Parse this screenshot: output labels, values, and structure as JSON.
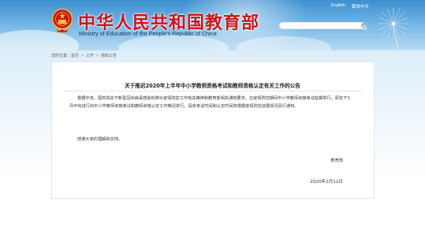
{
  "header": {
    "title_zh": "中华人民共和国教育部",
    "title_en": "Ministry of Education of the People's Republic of China",
    "links": [
      {
        "label": "English"
      },
      {
        "label": "繁体中文"
      }
    ],
    "search": {
      "placeholder": ""
    }
  },
  "breadcrumb": [
    "您的位置：首页",
    "公开",
    "通知公告"
  ],
  "article": {
    "title": "关于推迟2020年上半年中小学教师资格考试和教师资格认定有关工作的公告",
    "paragraphs": [
      "根据中央、国务院关于新型冠状病毒感染的肺炎疫情防控工作有关精神和教育部相关通知要求，在疫情防控期间中小学教师资格考试延期举行。原定于3月中旬进行的中小学教师资格考试和教师资格认定工作推迟举行。具体考试时间和认定时间将根据疫情防控进展情况另行通知。",
      "感谢大家的理解和支持。"
    ],
    "signature": "教育部",
    "date": "2020年2月12日"
  },
  "colors": {
    "brand_red": "#c8141b",
    "header_blue": "#3d8fd0"
  }
}
